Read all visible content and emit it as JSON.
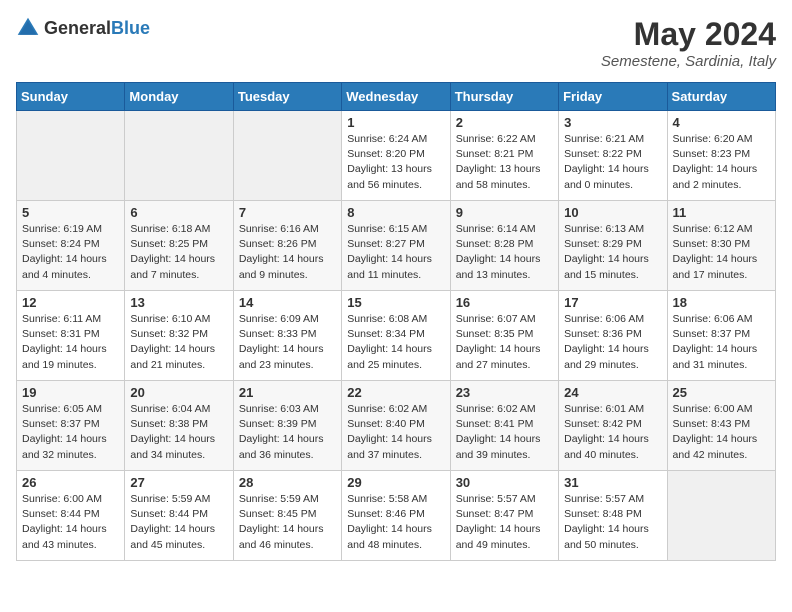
{
  "header": {
    "logo_general": "General",
    "logo_blue": "Blue",
    "title": "May 2024",
    "subtitle": "Semestene, Sardinia, Italy"
  },
  "weekdays": [
    "Sunday",
    "Monday",
    "Tuesday",
    "Wednesday",
    "Thursday",
    "Friday",
    "Saturday"
  ],
  "weeks": [
    [
      {
        "day": "",
        "info": ""
      },
      {
        "day": "",
        "info": ""
      },
      {
        "day": "",
        "info": ""
      },
      {
        "day": "1",
        "info": "Sunrise: 6:24 AM\nSunset: 8:20 PM\nDaylight: 13 hours and 56 minutes."
      },
      {
        "day": "2",
        "info": "Sunrise: 6:22 AM\nSunset: 8:21 PM\nDaylight: 13 hours and 58 minutes."
      },
      {
        "day": "3",
        "info": "Sunrise: 6:21 AM\nSunset: 8:22 PM\nDaylight: 14 hours and 0 minutes."
      },
      {
        "day": "4",
        "info": "Sunrise: 6:20 AM\nSunset: 8:23 PM\nDaylight: 14 hours and 2 minutes."
      }
    ],
    [
      {
        "day": "5",
        "info": "Sunrise: 6:19 AM\nSunset: 8:24 PM\nDaylight: 14 hours and 4 minutes."
      },
      {
        "day": "6",
        "info": "Sunrise: 6:18 AM\nSunset: 8:25 PM\nDaylight: 14 hours and 7 minutes."
      },
      {
        "day": "7",
        "info": "Sunrise: 6:16 AM\nSunset: 8:26 PM\nDaylight: 14 hours and 9 minutes."
      },
      {
        "day": "8",
        "info": "Sunrise: 6:15 AM\nSunset: 8:27 PM\nDaylight: 14 hours and 11 minutes."
      },
      {
        "day": "9",
        "info": "Sunrise: 6:14 AM\nSunset: 8:28 PM\nDaylight: 14 hours and 13 minutes."
      },
      {
        "day": "10",
        "info": "Sunrise: 6:13 AM\nSunset: 8:29 PM\nDaylight: 14 hours and 15 minutes."
      },
      {
        "day": "11",
        "info": "Sunrise: 6:12 AM\nSunset: 8:30 PM\nDaylight: 14 hours and 17 minutes."
      }
    ],
    [
      {
        "day": "12",
        "info": "Sunrise: 6:11 AM\nSunset: 8:31 PM\nDaylight: 14 hours and 19 minutes."
      },
      {
        "day": "13",
        "info": "Sunrise: 6:10 AM\nSunset: 8:32 PM\nDaylight: 14 hours and 21 minutes."
      },
      {
        "day": "14",
        "info": "Sunrise: 6:09 AM\nSunset: 8:33 PM\nDaylight: 14 hours and 23 minutes."
      },
      {
        "day": "15",
        "info": "Sunrise: 6:08 AM\nSunset: 8:34 PM\nDaylight: 14 hours and 25 minutes."
      },
      {
        "day": "16",
        "info": "Sunrise: 6:07 AM\nSunset: 8:35 PM\nDaylight: 14 hours and 27 minutes."
      },
      {
        "day": "17",
        "info": "Sunrise: 6:06 AM\nSunset: 8:36 PM\nDaylight: 14 hours and 29 minutes."
      },
      {
        "day": "18",
        "info": "Sunrise: 6:06 AM\nSunset: 8:37 PM\nDaylight: 14 hours and 31 minutes."
      }
    ],
    [
      {
        "day": "19",
        "info": "Sunrise: 6:05 AM\nSunset: 8:37 PM\nDaylight: 14 hours and 32 minutes."
      },
      {
        "day": "20",
        "info": "Sunrise: 6:04 AM\nSunset: 8:38 PM\nDaylight: 14 hours and 34 minutes."
      },
      {
        "day": "21",
        "info": "Sunrise: 6:03 AM\nSunset: 8:39 PM\nDaylight: 14 hours and 36 minutes."
      },
      {
        "day": "22",
        "info": "Sunrise: 6:02 AM\nSunset: 8:40 PM\nDaylight: 14 hours and 37 minutes."
      },
      {
        "day": "23",
        "info": "Sunrise: 6:02 AM\nSunset: 8:41 PM\nDaylight: 14 hours and 39 minutes."
      },
      {
        "day": "24",
        "info": "Sunrise: 6:01 AM\nSunset: 8:42 PM\nDaylight: 14 hours and 40 minutes."
      },
      {
        "day": "25",
        "info": "Sunrise: 6:00 AM\nSunset: 8:43 PM\nDaylight: 14 hours and 42 minutes."
      }
    ],
    [
      {
        "day": "26",
        "info": "Sunrise: 6:00 AM\nSunset: 8:44 PM\nDaylight: 14 hours and 43 minutes."
      },
      {
        "day": "27",
        "info": "Sunrise: 5:59 AM\nSunset: 8:44 PM\nDaylight: 14 hours and 45 minutes."
      },
      {
        "day": "28",
        "info": "Sunrise: 5:59 AM\nSunset: 8:45 PM\nDaylight: 14 hours and 46 minutes."
      },
      {
        "day": "29",
        "info": "Sunrise: 5:58 AM\nSunset: 8:46 PM\nDaylight: 14 hours and 48 minutes."
      },
      {
        "day": "30",
        "info": "Sunrise: 5:57 AM\nSunset: 8:47 PM\nDaylight: 14 hours and 49 minutes."
      },
      {
        "day": "31",
        "info": "Sunrise: 5:57 AM\nSunset: 8:48 PM\nDaylight: 14 hours and 50 minutes."
      },
      {
        "day": "",
        "info": ""
      }
    ]
  ]
}
